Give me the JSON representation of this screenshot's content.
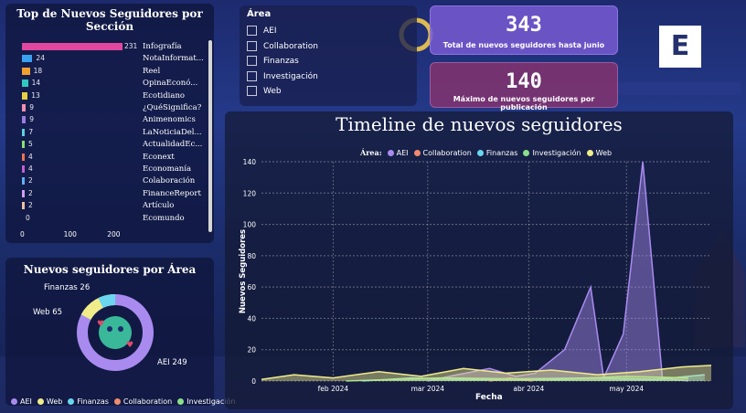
{
  "top_seguidores": {
    "title": "Top de Nuevos Seguidores por Sección",
    "rows": [
      {
        "label": "Infografía",
        "value": 231,
        "color": "#e0479e"
      },
      {
        "label": "NotaInformat...",
        "value": 24,
        "color": "#3aa0f0"
      },
      {
        "label": "Reel",
        "value": 18,
        "color": "#f0a030"
      },
      {
        "label": "OpinaEconó...",
        "value": 14,
        "color": "#30c8c0"
      },
      {
        "label": "Ecotidiano",
        "value": 13,
        "color": "#e8d040"
      },
      {
        "label": "¿QuéSignifica?",
        "value": 9,
        "color": "#f090b0"
      },
      {
        "label": "Animenomics",
        "value": 9,
        "color": "#9b7be0"
      },
      {
        "label": "LaNoticiaDel...",
        "value": 7,
        "color": "#5ad0e0"
      },
      {
        "label": "ActualidadEc...",
        "value": 5,
        "color": "#8ae070"
      },
      {
        "label": "Econext",
        "value": 4,
        "color": "#f07050"
      },
      {
        "label": "Economanía",
        "value": 4,
        "color": "#c060d0"
      },
      {
        "label": "Colaboración",
        "value": 2,
        "color": "#60b0f0"
      },
      {
        "label": "FinanceReport",
        "value": 2,
        "color": "#d0a0f0"
      },
      {
        "label": "Artículo",
        "value": 2,
        "color": "#f0c0a0"
      },
      {
        "label": "Ecomundo",
        "value": 0,
        "color": "#a0a0a0"
      }
    ],
    "axis_ticks": [
      "0",
      "100",
      "200"
    ]
  },
  "area_donut": {
    "title": "Nuevos seguidores por Área",
    "labels": {
      "finanzas": "Finanzas 26",
      "web": "Web 65",
      "aei": "AEI 249"
    },
    "legend": [
      {
        "name": "AEI",
        "color": "#a98bf0"
      },
      {
        "name": "Web",
        "color": "#f0ec8a"
      },
      {
        "name": "Finanzas",
        "color": "#6ad6f0"
      },
      {
        "name": "Collaboration",
        "color": "#f08a70"
      },
      {
        "name": "Investigación",
        "color": "#8ae08a"
      }
    ]
  },
  "filter": {
    "title": "Área",
    "options": [
      "AEI",
      "Collaboration",
      "Finanzas",
      "Investigación",
      "Web"
    ]
  },
  "kpi1": {
    "value": "343",
    "label": "Total de nuevos seguidores hasta junio"
  },
  "kpi2": {
    "value": "140",
    "label": "Máximo de nuevos seguidores por publicación"
  },
  "logo": {
    "letter": "E"
  },
  "timeline": {
    "title": "Timeline de nuevos seguidores",
    "legend_title": "Área:",
    "xlabel": "Fecha",
    "ylabel": "Nuevos Seguidores"
  },
  "chart_data": {
    "type": "area",
    "title": "Timeline de nuevos seguidores",
    "xlabel": "Fecha",
    "ylabel": "Nuevos Seguidores",
    "ylim": [
      0,
      140
    ],
    "y_ticks": [
      0,
      20,
      40,
      60,
      80,
      100,
      120,
      140
    ],
    "x_ticks": [
      "feb 2024",
      "mar 2024",
      "abr 2024",
      "may 2024"
    ],
    "x_range": [
      "2024-01-10",
      "2024-05-27"
    ],
    "series": [
      {
        "name": "AEI",
        "color": "#a98bf0",
        "points": [
          [
            "2024-03-01",
            0
          ],
          [
            "2024-03-10",
            4
          ],
          [
            "2024-03-20",
            8
          ],
          [
            "2024-03-28",
            3
          ],
          [
            "2024-04-03",
            5
          ],
          [
            "2024-04-12",
            20
          ],
          [
            "2024-04-20",
            60
          ],
          [
            "2024-04-24",
            2
          ],
          [
            "2024-04-30",
            30
          ],
          [
            "2024-05-06",
            140
          ],
          [
            "2024-05-12",
            2
          ],
          [
            "2024-05-20",
            0
          ]
        ]
      },
      {
        "name": "Collaboration",
        "color": "#f08a70",
        "points": [
          [
            "2024-03-20",
            0
          ],
          [
            "2024-03-26",
            2
          ],
          [
            "2024-04-02",
            0
          ]
        ]
      },
      {
        "name": "Finanzas",
        "color": "#6ad6f0",
        "points": [
          [
            "2024-02-10",
            0
          ],
          [
            "2024-02-25",
            2
          ],
          [
            "2024-03-15",
            1
          ],
          [
            "2024-04-20",
            2
          ],
          [
            "2024-05-10",
            1
          ],
          [
            "2024-05-25",
            4
          ]
        ]
      },
      {
        "name": "Investigación",
        "color": "#8ae08a",
        "points": [
          [
            "2024-02-05",
            0
          ],
          [
            "2024-03-05",
            2
          ],
          [
            "2024-04-10",
            1
          ],
          [
            "2024-05-01",
            3
          ],
          [
            "2024-05-20",
            2
          ]
        ]
      },
      {
        "name": "Web",
        "color": "#f0ec8a",
        "points": [
          [
            "2024-01-10",
            1
          ],
          [
            "2024-01-20",
            4
          ],
          [
            "2024-02-01",
            2
          ],
          [
            "2024-02-15",
            6
          ],
          [
            "2024-02-28",
            3
          ],
          [
            "2024-03-12",
            8
          ],
          [
            "2024-03-25",
            5
          ],
          [
            "2024-04-08",
            7
          ],
          [
            "2024-04-22",
            4
          ],
          [
            "2024-05-05",
            6
          ],
          [
            "2024-05-18",
            9
          ],
          [
            "2024-05-27",
            10
          ]
        ]
      }
    ]
  }
}
